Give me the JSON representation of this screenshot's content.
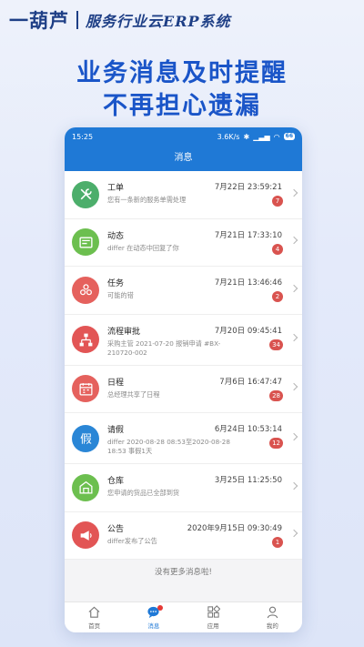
{
  "brand": {
    "logo": "一葫芦",
    "subtitle": "服务行业云ERP系统"
  },
  "headline": {
    "line1": "业务消息及时提醒",
    "line2": "不再担心遗漏"
  },
  "status_bar": {
    "time": "15:25",
    "speed": "3.6K/s",
    "signal": "···",
    "battery": "66"
  },
  "nav": {
    "title": "消息"
  },
  "colors": {
    "primary": "#1f79d6",
    "badge": "#d9534f"
  },
  "messages": [
    {
      "title": "工单",
      "time": "7月22日 23:59:21",
      "preview": "您有一条新的服务单需处理",
      "count": "7",
      "icon": "tools-icon",
      "color": "#4cae6b"
    },
    {
      "title": "动态",
      "time": "7月21日 17:33:10",
      "preview": "differ 在动态中回复了你",
      "count": "4",
      "icon": "news-icon",
      "color": "#6cbf4f"
    },
    {
      "title": "任务",
      "time": "7月21日 13:46:46",
      "preview": "可能的错",
      "count": "2",
      "icon": "task-icon",
      "color": "#e5615d"
    },
    {
      "title": "流程审批",
      "time": "7月20日 09:45:41",
      "preview": "采购主管 2021-07-20 报销申请 #BX-210720-002",
      "count": "34",
      "icon": "flow-icon",
      "color": "#e25555"
    },
    {
      "title": "日程",
      "time": "7月6日 16:47:47",
      "preview": "总经理共享了日程",
      "count": "28",
      "icon": "calendar-icon",
      "color": "#e5615d"
    },
    {
      "title": "请假",
      "time": "6月24日 10:53:14",
      "preview": "differ 2020-08-28 08:53至2020-08-28 18:53 事假1天",
      "count": "12",
      "icon": "leave-icon",
      "color": "#2a86d6"
    },
    {
      "title": "仓库",
      "time": "3月25日 11:25:50",
      "preview": "您申请的货品已全部到货",
      "count": "",
      "icon": "warehouse-icon",
      "color": "#6cbf4f"
    },
    {
      "title": "公告",
      "time": "2020年9月15日 09:30:49",
      "preview": "differ发布了公告",
      "count": "1",
      "icon": "notice-icon",
      "color": "#e25555"
    }
  ],
  "no_more": "没有更多消息啦!",
  "tabs": [
    {
      "label": "首页",
      "icon": "home-icon"
    },
    {
      "label": "消息",
      "icon": "chat-icon"
    },
    {
      "label": "应用",
      "icon": "apps-icon"
    },
    {
      "label": "我的",
      "icon": "user-icon"
    }
  ]
}
